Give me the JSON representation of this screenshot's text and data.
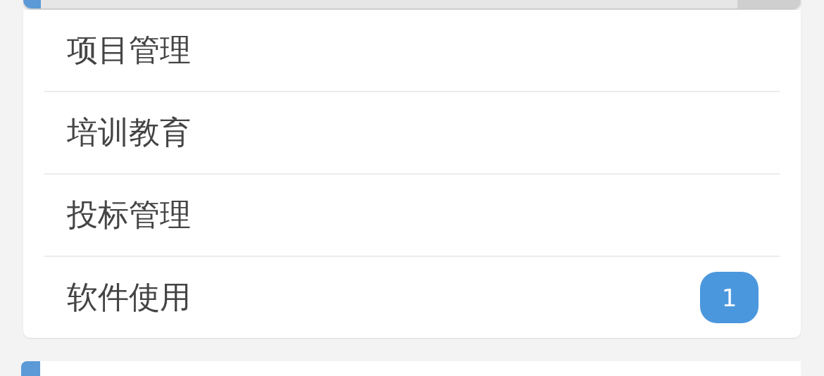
{
  "items": [
    {
      "label": "项目管理"
    },
    {
      "label": "培训教育"
    },
    {
      "label": "投标管理"
    },
    {
      "label": "软件使用",
      "badge": "1"
    }
  ]
}
